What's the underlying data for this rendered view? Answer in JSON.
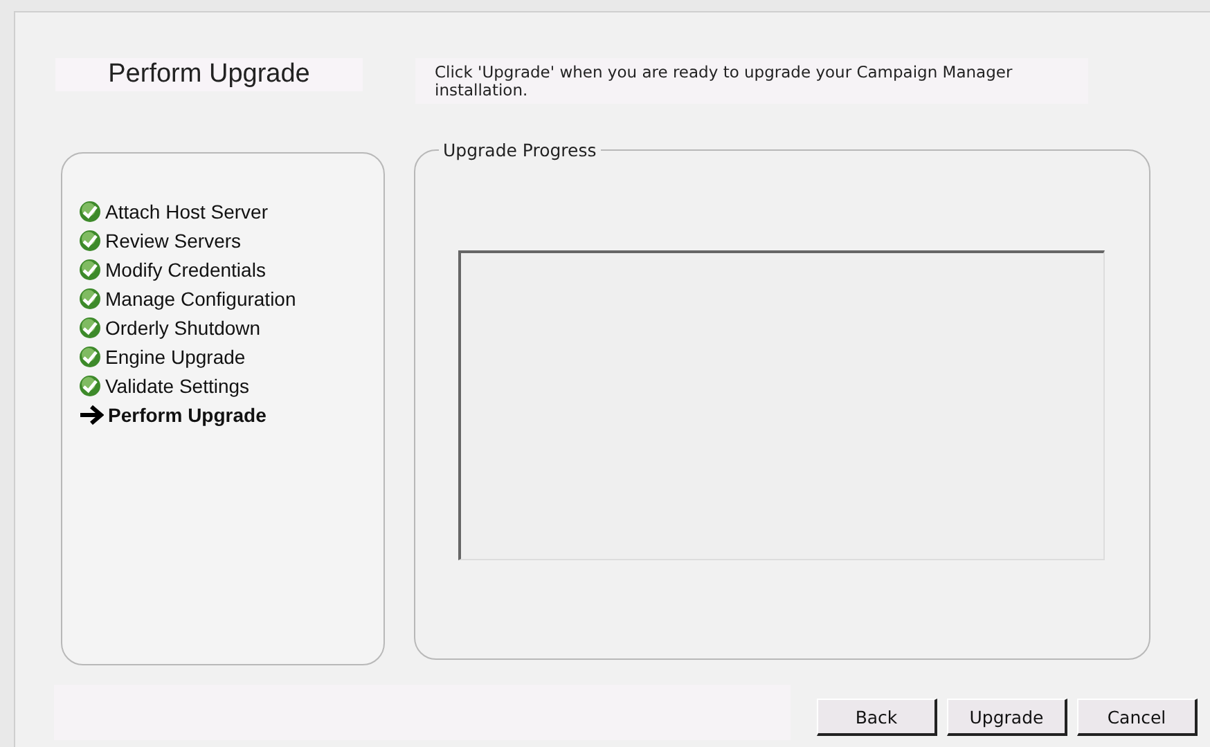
{
  "title": "Perform Upgrade",
  "instructions": "Click 'Upgrade' when you are ready to upgrade your Campaign Manager installation.",
  "steps": [
    {
      "label": "Attach Host Server",
      "kind": "done"
    },
    {
      "label": "Review Servers",
      "kind": "done"
    },
    {
      "label": "Modify Credentials",
      "kind": "done"
    },
    {
      "label": "Manage Configuration",
      "kind": "done"
    },
    {
      "label": "Orderly Shutdown",
      "kind": "done"
    },
    {
      "label": "Engine Upgrade",
      "kind": "done"
    },
    {
      "label": "Validate Settings",
      "kind": "done"
    },
    {
      "label": "Perform Upgrade",
      "kind": "current"
    }
  ],
  "progress": {
    "legend": "Upgrade Progress"
  },
  "buttons": [
    "Back",
    "Upgrade",
    "Cancel"
  ]
}
